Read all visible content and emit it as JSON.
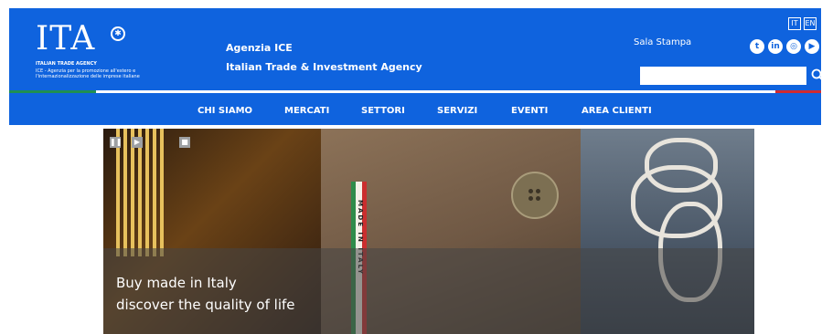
{
  "brand": {
    "logo_text": "ITA",
    "logo_subtitle": "ITALIAN TRADE AGENCY",
    "logo_tagline_1": "ICE - Agenzia per la promozione all'estero e",
    "logo_tagline_2": "l'internazionalizzazione delle imprese italiane"
  },
  "agency": {
    "line1": "Agenzia ICE",
    "line2": "Italian Trade & Investment Agency"
  },
  "top_links": {
    "languages": [
      "IT",
      "EN"
    ],
    "press": "Sala Stampa",
    "social_icons": [
      "twitter-icon",
      "linkedin-icon",
      "instagram-icon",
      "youtube-icon"
    ]
  },
  "search": {
    "value": "",
    "placeholder": ""
  },
  "nav": {
    "items": [
      "CHI SIAMO",
      "MERCATI",
      "SETTORI",
      "SERVIZI",
      "EVENTI",
      "AREA CLIENTI"
    ]
  },
  "hero": {
    "caption_line1": "Buy made in Italy",
    "caption_line2": "discover the quality of life",
    "tape_text": "MADE IN ITALY"
  },
  "colors": {
    "header_blue": "#0f63de",
    "flag_green": "#1f8f52",
    "flag_red": "#cf2a2f"
  }
}
